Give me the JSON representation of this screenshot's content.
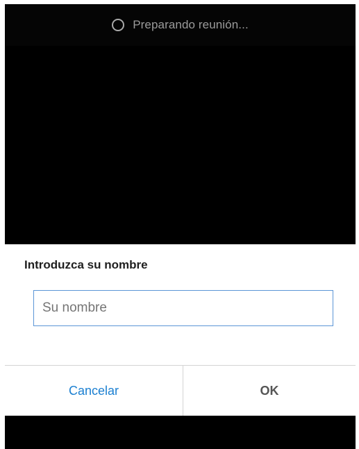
{
  "status_bar": {
    "spinner_icon": "loading-spinner-icon",
    "text": "Preparando reunión..."
  },
  "dialog": {
    "title": "Introduzca su nombre",
    "input": {
      "value": "",
      "placeholder": "Su nombre"
    },
    "cancel_label": "Cancelar",
    "ok_label": "OK"
  },
  "colors": {
    "background": "#000000",
    "dialog_background": "#ffffff",
    "input_border": "#5b95d6",
    "cancel_text": "#1a7fd1",
    "ok_text": "#555555",
    "status_text": "#9b9b9b"
  }
}
